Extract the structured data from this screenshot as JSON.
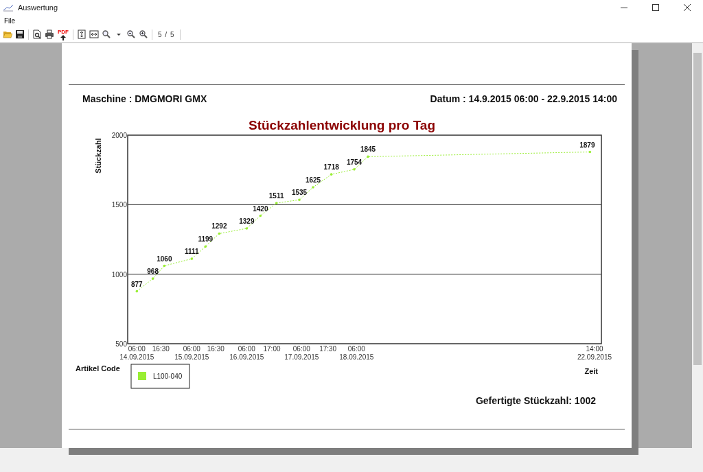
{
  "window": {
    "title": "Auswertung"
  },
  "menu": [
    "File"
  ],
  "toolbar": {
    "pdf_label": "PDF",
    "page_indicator": "5 / 5"
  },
  "report": {
    "machine": "Maschine : DMGMORI GMX",
    "date_range": "Datum : 14.9.2015 06:00 - 22.9.2015 14:00",
    "legend_title": "Artikel Code",
    "total": "Gefertigte Stückzahl: 1002",
    "chart_data": {
      "type": "line",
      "title": "Stückzahlentwicklung pro Tag",
      "xlabel": "Zeit",
      "ylabel": "Stückzahl",
      "x": [
        "2015-09-14 06:00",
        "2015-09-14 13:00",
        "2015-09-14 18:00",
        "2015-09-15 06:00",
        "2015-09-15 12:00",
        "2015-09-15 18:00",
        "2015-09-16 06:00",
        "2015-09-16 12:00",
        "2015-09-16 19:00",
        "2015-09-17 05:00",
        "2015-09-17 11:00",
        "2015-09-17 19:00",
        "2015-09-18 05:00",
        "2015-09-18 11:00",
        "2015-09-22 12:00"
      ],
      "series": [
        {
          "name": "L100-040",
          "color": "#99ee33",
          "line_style": "dashed",
          "values": [
            877,
            968,
            1060,
            1111,
            1199,
            1292,
            1329,
            1420,
            1511,
            1535,
            1625,
            1718,
            1754,
            1845,
            1879
          ]
        }
      ],
      "xlim": [
        "2015-09-14 02:00",
        "2015-09-22 17:00"
      ],
      "ylim": [
        500,
        2000
      ],
      "xticks": [
        {
          "value": "2015-09-14 06:00",
          "label": "06:00 14.09.2015"
        },
        {
          "value": "2015-09-14 16:30",
          "label": "16:30"
        },
        {
          "value": "2015-09-15 06:00",
          "label": "06:00 15.09.2015"
        },
        {
          "value": "2015-09-15 16:30",
          "label": "16:30"
        },
        {
          "value": "2015-09-16 06:00",
          "label": "06:00 16.09.2015"
        },
        {
          "value": "2015-09-16 17:00",
          "label": "17:00"
        },
        {
          "value": "2015-09-17 06:00",
          "label": "06:00 17.09.2015"
        },
        {
          "value": "2015-09-17 17:30",
          "label": "17:30"
        },
        {
          "value": "2015-09-18 06:00",
          "label": "06:00 18.09.2015"
        },
        {
          "value": "2015-09-22 14:00",
          "label": "14:00 22.09.2015"
        }
      ],
      "yticks": [
        500,
        1000,
        1500,
        2000
      ],
      "data_labels": true
    }
  }
}
